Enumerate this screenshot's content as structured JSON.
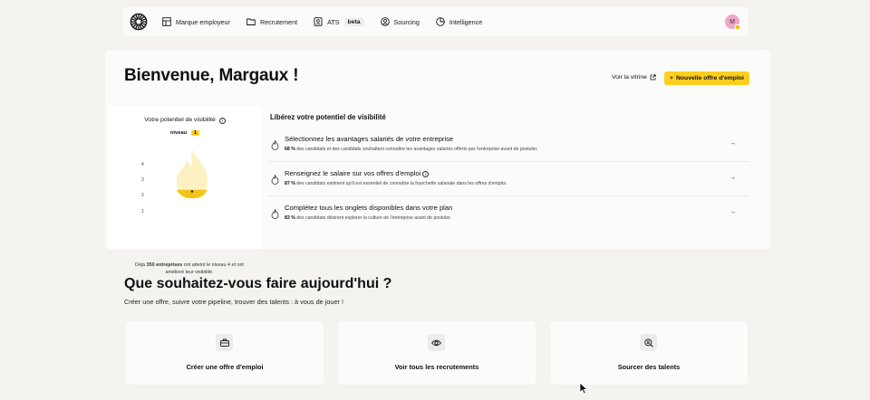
{
  "nav": {
    "items": [
      {
        "label": "Marque employeur",
        "icon": "layout-icon"
      },
      {
        "label": "Recrutement",
        "icon": "folder-icon"
      },
      {
        "label": "ATS",
        "icon": "ats-icon",
        "badge": "beta"
      },
      {
        "label": "Sourcing",
        "icon": "user-circle-icon"
      },
      {
        "label": "Intelligence",
        "icon": "pie-chart-icon"
      }
    ],
    "avatar_initial": "M"
  },
  "welcome": {
    "title": "Bienvenue, Margaux !",
    "vitrine_label": "Voir la vitrine",
    "new_offer_label": "Nouvelle offre d'emploi"
  },
  "visibility": {
    "title": "Votre potentiel de visibilité",
    "level_label": "niveau",
    "level_value": "1",
    "levels": [
      "4",
      "3",
      "2",
      "1"
    ],
    "current_level": 1,
    "footer_prefix": "Déjà ",
    "footer_bold": "350 entreprises",
    "footer_suffix": " ont atteint le niveau 4 et ont amélioré leur visibilité."
  },
  "tasks": {
    "title": "Libérez votre potentiel de visibilité",
    "items": [
      {
        "title": "Sélectionnez les avantages salariés de votre entreprise",
        "pct": "68 %",
        "desc": " des candidats et des candidats souhaitent connaître les avantages salariés offerts par l'entreprise avant de postuler."
      },
      {
        "title": "Renseignez le salaire sur vos offres d'emploi",
        "pct": "87 %",
        "desc": " des candidats estiment qu'il est essentiel de connaître la fourchette salariale dans les offres d'emploi."
      },
      {
        "title": "Complétez tous les onglets disponibles dans votre plan",
        "pct": "83 %",
        "desc": " des candidats désirent explorer la culture de l'entreprise avant de postuler."
      }
    ]
  },
  "actions": {
    "title": "Que souhaitez-vous faire aujourd'hui ?",
    "subtitle": "Créer une offre, suivre votre pipeline, trouver des talents : à vous de jouer !",
    "cards": [
      {
        "label": "Créer une offre d'emploi",
        "icon": "briefcase-icon"
      },
      {
        "label": "Voir tous les recrutements",
        "icon": "eye-icon"
      },
      {
        "label": "Sourcer des talents",
        "icon": "search-user-icon"
      }
    ]
  },
  "colors": {
    "accent": "#fccf1f",
    "background": "#f4f3f0",
    "card": "#fbfbfa"
  }
}
